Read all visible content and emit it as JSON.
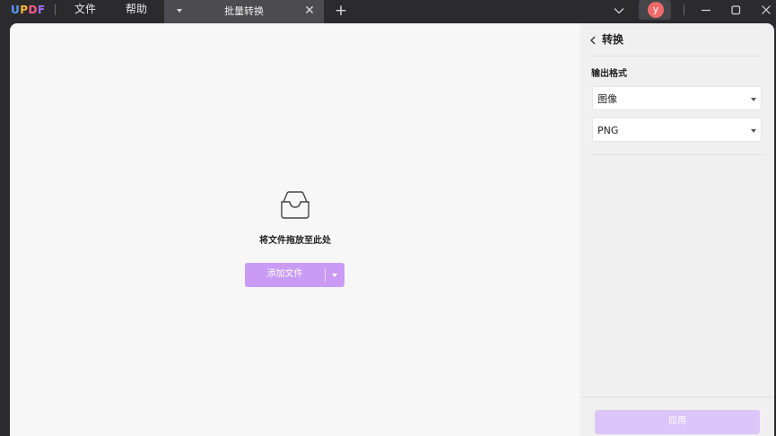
{
  "app": {
    "logo_letters": [
      "U",
      "P",
      "D",
      "F"
    ],
    "logo_colors": [
      "#5b9bff",
      "#f7b731",
      "#ff5c8a",
      "#a66bff"
    ]
  },
  "menu": {
    "file": "文件",
    "help": "帮助"
  },
  "tab": {
    "title": "批量转换",
    "close_glyph": "✕",
    "add_glyph": "+"
  },
  "user": {
    "avatar_initial": "y",
    "avatar_color": "#f06a6a"
  },
  "main": {
    "drop_hint": "将文件拖放至此处",
    "add_file_label": "添加文件",
    "accent_color": "#c99bf5"
  },
  "panel": {
    "title": "转换",
    "output_format_label": "输出格式",
    "format_value": "图像",
    "subformat_value": "PNG",
    "apply_label": "应用"
  },
  "icons": {
    "back": "chevron-left-icon",
    "drop": "inbox-tray-icon",
    "dropdown": "chevron-down-icon",
    "minimize": "minimize-icon",
    "maximize": "maximize-icon",
    "close": "close-icon"
  }
}
